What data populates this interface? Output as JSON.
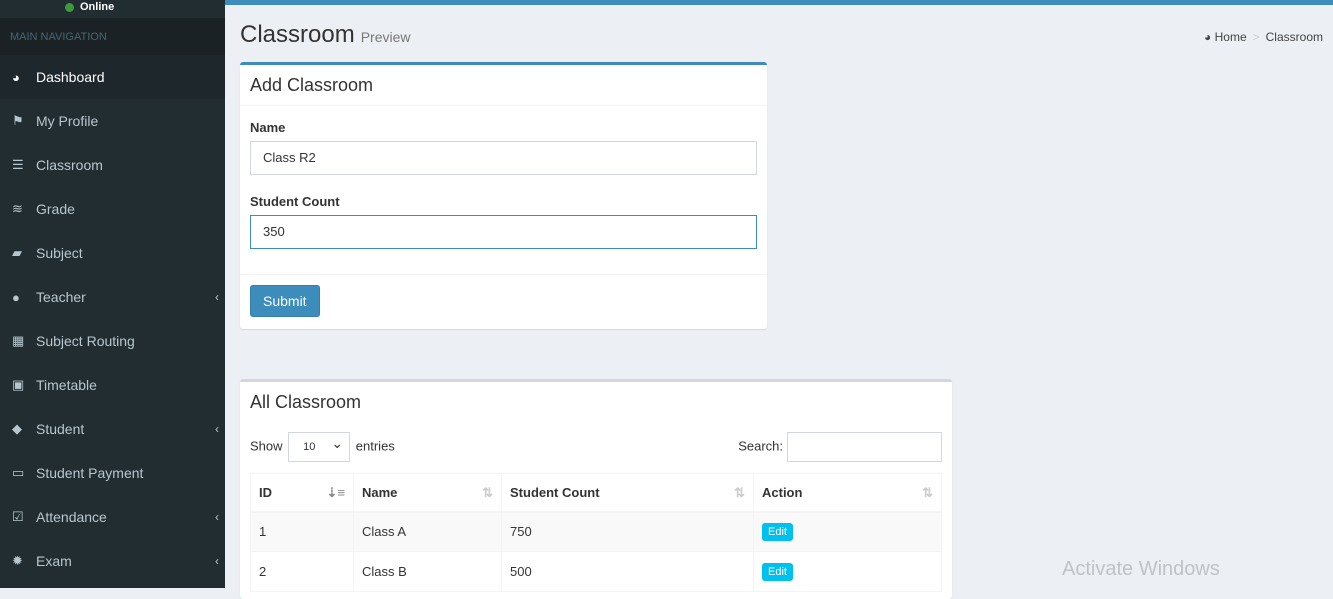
{
  "sidebar": {
    "status": "Online",
    "nav_header": "MAIN NAVIGATION",
    "items": [
      {
        "label": "Dashboard",
        "icon": "dashboard-icon"
      },
      {
        "label": "My Profile",
        "icon": "flag-icon"
      },
      {
        "label": "Classroom",
        "icon": "list-icon"
      },
      {
        "label": "Grade",
        "icon": "database-icon"
      },
      {
        "label": "Subject",
        "icon": "book-icon"
      },
      {
        "label": "Teacher",
        "icon": "user-icon"
      },
      {
        "label": "Subject Routing",
        "icon": "grid-icon"
      },
      {
        "label": "Timetable",
        "icon": "calendar-plus-icon"
      },
      {
        "label": "Student",
        "icon": "graduation-cap-icon"
      },
      {
        "label": "Student Payment",
        "icon": "money-icon"
      },
      {
        "label": "Attendance",
        "icon": "calendar-check-icon"
      },
      {
        "label": "Exam",
        "icon": "gear-icon"
      }
    ]
  },
  "header": {
    "title": "Classroom",
    "subtitle": "Preview",
    "breadcrumb": [
      "Home",
      "Classroom"
    ]
  },
  "form": {
    "title": "Add Classroom",
    "name_label": "Name",
    "name_value": "Class R2",
    "count_label": "Student Count",
    "count_value": "350",
    "submit": "Submit"
  },
  "list": {
    "title": "All Classroom",
    "show": "Show",
    "entries_value": "10",
    "entries": "entries",
    "search": "Search:",
    "columns": [
      "ID",
      "Name",
      "Student Count",
      "Action"
    ],
    "rows": [
      {
        "id": "1",
        "name": "Class A",
        "count": "750",
        "action": "Edit"
      },
      {
        "id": "2",
        "name": "Class B",
        "count": "500",
        "action": "Edit"
      }
    ]
  },
  "watermark": "Activate Windows"
}
